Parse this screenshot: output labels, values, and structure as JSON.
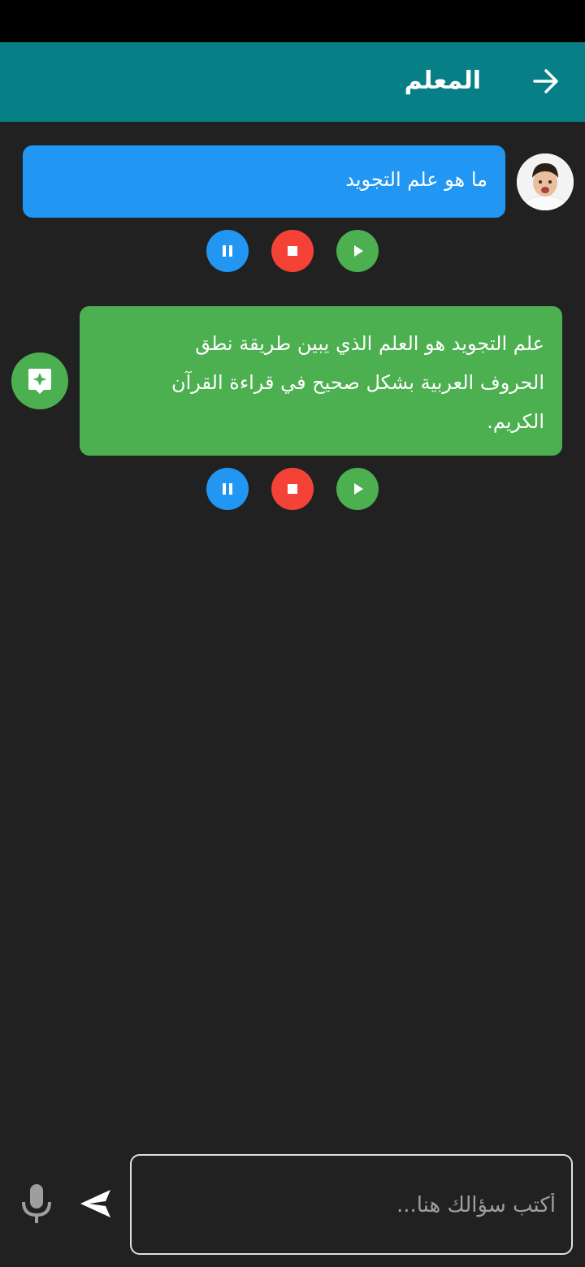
{
  "header": {
    "title": "المعلم",
    "back_icon": "arrow-right-icon",
    "background": "#077f86"
  },
  "messages": [
    {
      "sender": "user",
      "text": "ما هو علم التجويد",
      "color": "#2196f3"
    },
    {
      "sender": "bot",
      "lines": [
        "علم التجويد هو العلم الذي يبين طريقة نطق",
        "الحروف العربية بشكل صحيح في قراءة القرآن",
        "الكريم."
      ],
      "color": "#4caf50"
    }
  ],
  "controls": {
    "pause_icon": "pause-icon",
    "stop_icon": "stop-icon",
    "play_icon": "play-icon",
    "colors": {
      "pause": "#2196f3",
      "stop": "#f44336",
      "play": "#4caf50"
    }
  },
  "composer": {
    "placeholder": "أكتب سؤالك هنا...",
    "value": "",
    "send_icon": "send-icon",
    "mic_icon": "mic-icon"
  }
}
